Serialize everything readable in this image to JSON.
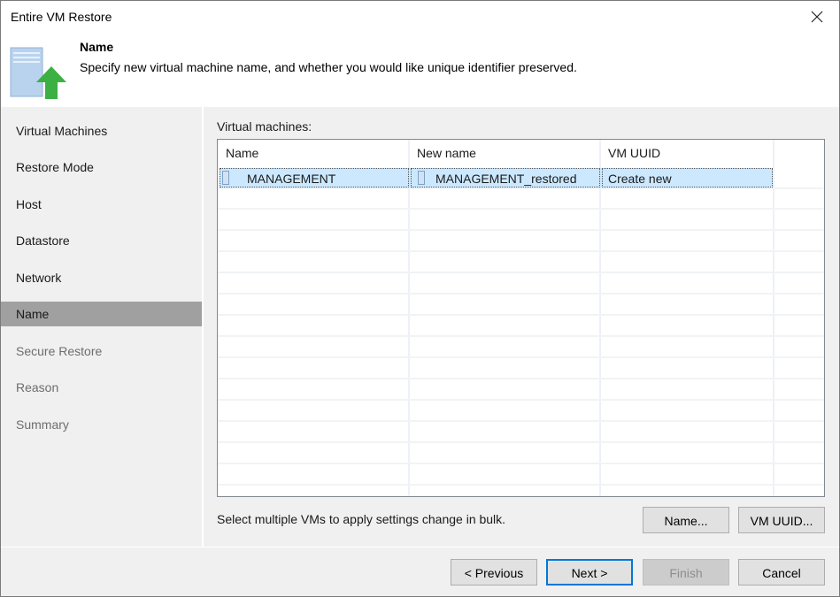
{
  "window": {
    "title": "Entire VM Restore",
    "close_icon": "close-icon"
  },
  "header": {
    "icon": "vm-restore-icon",
    "title": "Name",
    "subtitle": "Specify new virtual machine name, and whether you would like unique identifier preserved."
  },
  "sidebar": {
    "items": [
      {
        "label": "Virtual Machines",
        "state": "enabled"
      },
      {
        "label": "Restore Mode",
        "state": "enabled"
      },
      {
        "label": "Host",
        "state": "enabled"
      },
      {
        "label": "Datastore",
        "state": "enabled"
      },
      {
        "label": "Network",
        "state": "enabled"
      },
      {
        "label": "Name",
        "state": "active"
      },
      {
        "label": "Secure Restore",
        "state": "disabled"
      },
      {
        "label": "Reason",
        "state": "disabled"
      },
      {
        "label": "Summary",
        "state": "disabled"
      }
    ]
  },
  "main": {
    "list_label": "Virtual machines:",
    "columns": [
      "Name",
      "New name",
      "VM UUID"
    ],
    "rows": [
      {
        "name": "MANAGEMENT",
        "new_name": "MANAGEMENT_restored",
        "vm_uuid": "Create new",
        "selected": true
      }
    ],
    "hint": "Select multiple VMs to apply settings change in bulk.",
    "name_button": "Name...",
    "uuid_button": "VM UUID..."
  },
  "footer": {
    "previous": "< Previous",
    "next": "Next >",
    "finish": "Finish",
    "cancel": "Cancel"
  },
  "colors": {
    "selection": "#cce8ff",
    "active_step": "#a0a0a0",
    "default_button_border": "#0078d7",
    "arrow_green": "#3cb043"
  }
}
